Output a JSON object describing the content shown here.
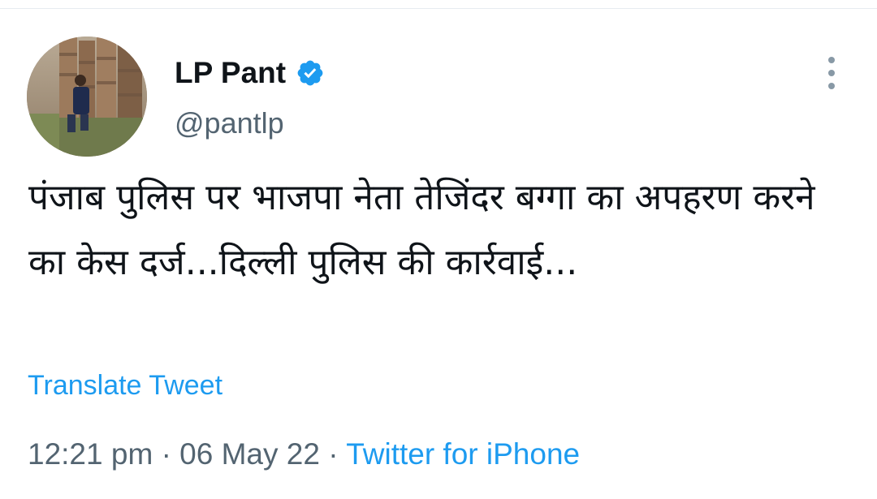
{
  "tweet": {
    "author": {
      "display_name": "LP Pant",
      "handle": "@pantlp",
      "verified": true
    },
    "text": "पंजाब पुलिस पर भाजपा नेता तेजिंदर बग्गा का अपहरण करने का केस दर्ज...दिल्ली पुलिस की कार्रवाई...",
    "translate_label": "Translate Tweet",
    "time": "12:21 pm",
    "separator": "·",
    "date": "06 May 22",
    "source": "Twitter for iPhone"
  },
  "colors": {
    "link_blue": "#1d9bf0",
    "muted_text": "#536471",
    "primary_text": "#0f1419",
    "verified_blue": "#1d9bf0"
  },
  "icons": {
    "verified": "verified-badge-icon",
    "more": "more-vertical-icon"
  }
}
